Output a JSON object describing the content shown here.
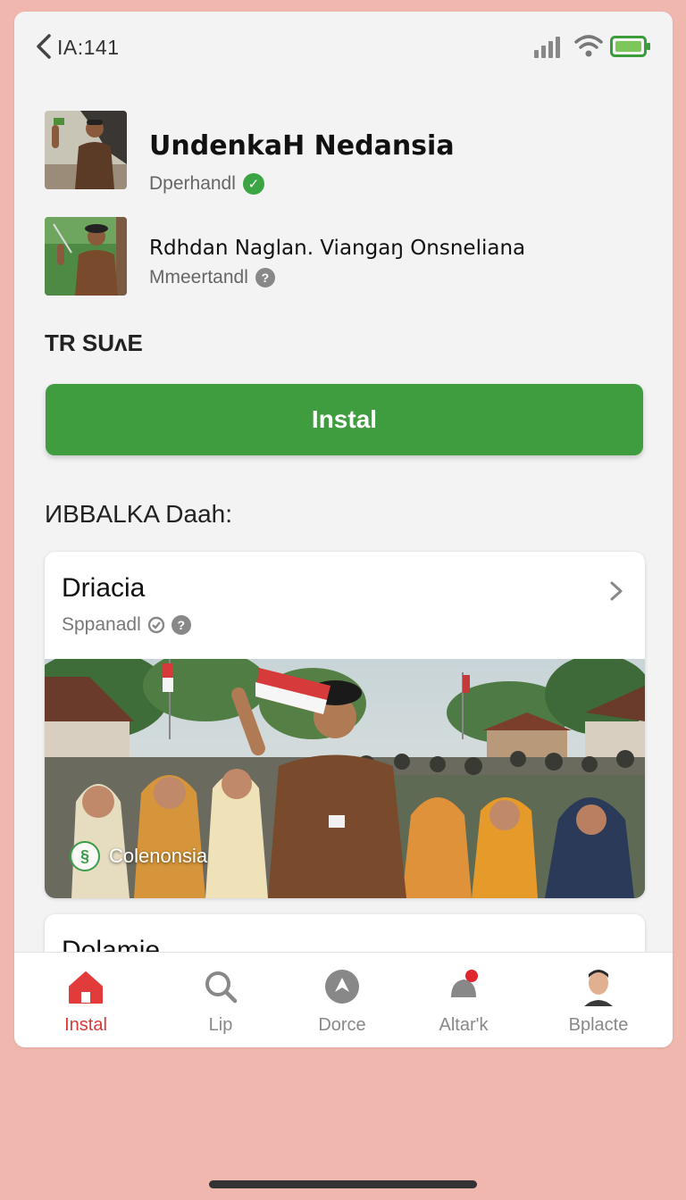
{
  "status": {
    "time": "IA:141"
  },
  "apps": [
    {
      "title": "UndenkaH Nedansia",
      "subtitle": "Dperhandl"
    },
    {
      "title": "Rdhdan Naglan. Viangaŋ Onsneliana",
      "subtitle": "Mmeertandl"
    }
  ],
  "section": {
    "title": "TR SUʌE",
    "install_label": "Instal"
  },
  "list": {
    "title": "ИBBALKA Daah:",
    "card": {
      "title": "Driacia",
      "subtitle": "Sppanadl",
      "badge_text": "Colenonsia"
    },
    "card2": {
      "title": "Dolamie"
    }
  },
  "tabs": [
    {
      "label": "Instal",
      "icon": "home-icon",
      "active": true
    },
    {
      "label": "Lip",
      "icon": "search-icon",
      "active": false
    },
    {
      "label": "Dorce",
      "icon": "compass-icon",
      "active": false
    },
    {
      "label": "Altar'k",
      "icon": "notifications-icon",
      "active": false
    },
    {
      "label": "Bplacte",
      "icon": "avatar-icon",
      "active": false
    }
  ],
  "colors": {
    "accent_green": "#3f9c3f",
    "active_tab": "#d83a3a",
    "background": "#f0b7ae"
  }
}
